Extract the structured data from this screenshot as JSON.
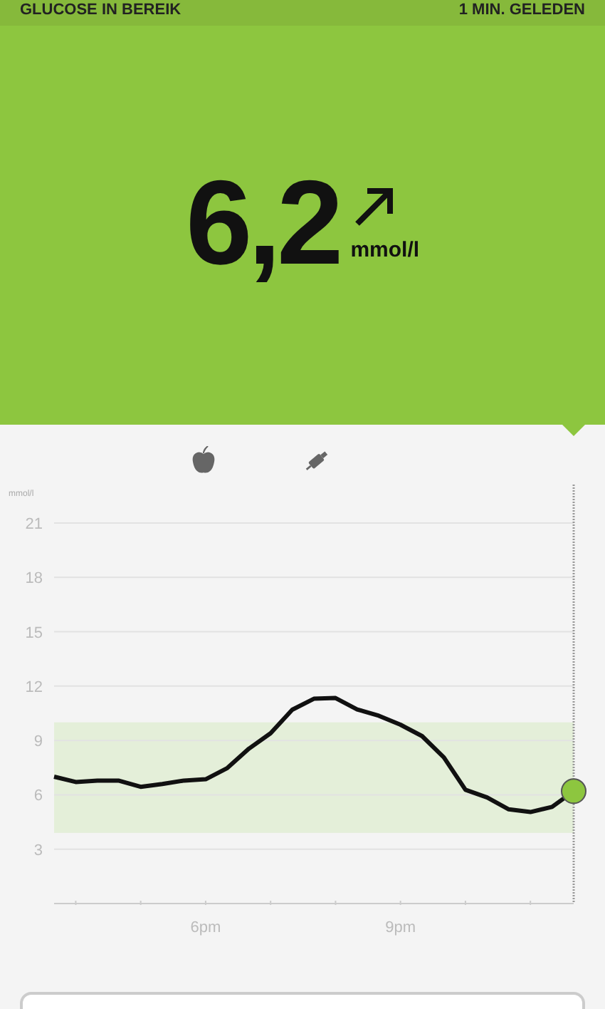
{
  "status_bar": {
    "status": "GLUCOSE IN BEREIK",
    "updated": "1 MIN. GELEDEN"
  },
  "reading": {
    "value": "6,2",
    "unit": "mmol/l"
  },
  "events": [
    {
      "kind": "meal"
    },
    {
      "kind": "insulin"
    }
  ],
  "chart_data": {
    "type": "line",
    "ylabel": "mmol/l",
    "ylim": [
      0,
      21
    ],
    "grid": true,
    "yticks": [
      3,
      6,
      9,
      12,
      15,
      18,
      21
    ],
    "bands": [
      {
        "axis": "y",
        "from": 3.9,
        "to": 10
      }
    ],
    "categories": [
      null,
      null,
      null,
      null,
      null,
      null,
      null,
      "6pm",
      null,
      null,
      null,
      null,
      null,
      null,
      null,
      null,
      "9pm",
      null,
      null,
      null,
      null,
      null,
      null,
      null,
      null
    ],
    "series": [
      {
        "color": "#111111",
        "values": [
          7.0,
          6.71,
          6.79,
          6.78,
          6.44,
          6.6,
          6.79,
          6.86,
          7.48,
          8.55,
          9.4,
          10.7,
          11.3,
          11.34,
          10.71,
          10.37,
          9.87,
          9.24,
          8.07,
          6.28,
          5.85,
          5.2,
          5.05,
          5.33,
          6.2
        ]
      }
    ]
  }
}
